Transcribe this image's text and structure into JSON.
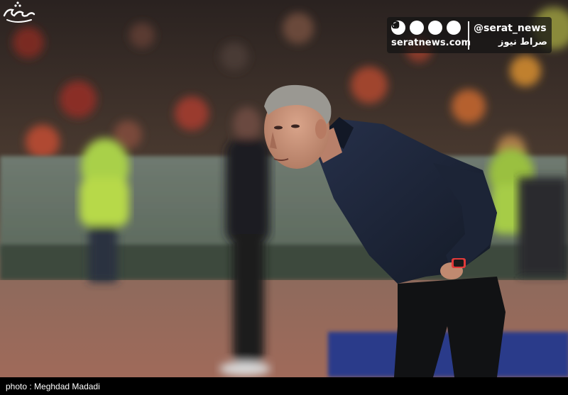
{
  "watermark": {
    "handle": "@serat_news",
    "site_url": "seratnews.com",
    "logo_text": "صراط نیوز",
    "icons": [
      "telegram-icon",
      "twitter-icon",
      "instagram-icon",
      "aparat-icon"
    ]
  },
  "agency_mark": {
    "logo_text": "تسنیم"
  },
  "credit": {
    "text": "photo : Meghdad Madadi"
  },
  "colors": {
    "jacket": "#1c2433",
    "background_dark": "#2b2420",
    "track": "#8a5a4a",
    "badge_bg": "#141414"
  }
}
